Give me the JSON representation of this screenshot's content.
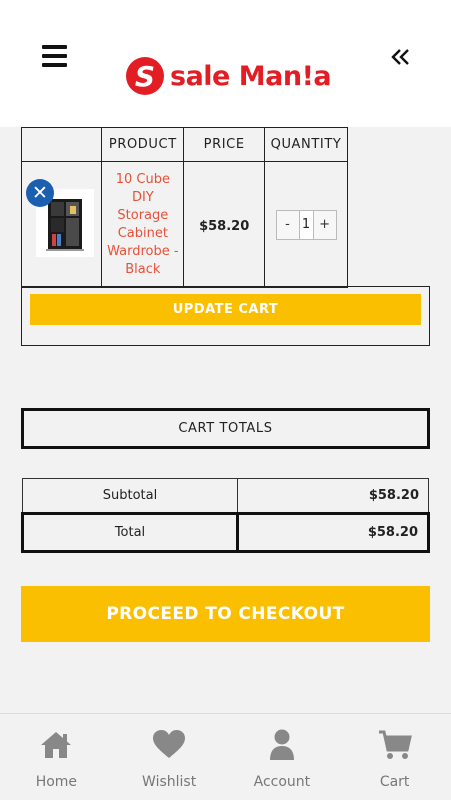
{
  "header": {
    "logo_letter": "S",
    "logo_text": "sale Man!a"
  },
  "cart": {
    "columns": [
      "",
      "PRODUCT",
      "PRICE",
      "QUANTITY"
    ],
    "item": {
      "remove_symbol": "✕",
      "product_name": "10 Cube DIY Storage Cabinet Wardrobe - Black",
      "price": "$58.20",
      "quantity": "1",
      "minus": "-",
      "plus": "+"
    },
    "update_label": "UPDATE CART"
  },
  "totals": {
    "heading": "CART TOTALS",
    "subtotal_label": "Subtotal",
    "subtotal_value": "$58.20",
    "total_label": "Total",
    "total_value": "$58.20"
  },
  "checkout_label": "PROCEED TO CHECKOUT",
  "nav": {
    "items": [
      {
        "label": "Home",
        "icon": "home-icon"
      },
      {
        "label": "Wishlist",
        "icon": "heart-icon"
      },
      {
        "label": "Account",
        "icon": "user-icon"
      },
      {
        "label": "Cart",
        "icon": "cart-icon"
      }
    ]
  },
  "colors": {
    "brand_red": "#e31d24",
    "accent_yellow": "#fbbf02",
    "remove_blue": "#1b5fb0",
    "product_link": "#e8503a"
  }
}
